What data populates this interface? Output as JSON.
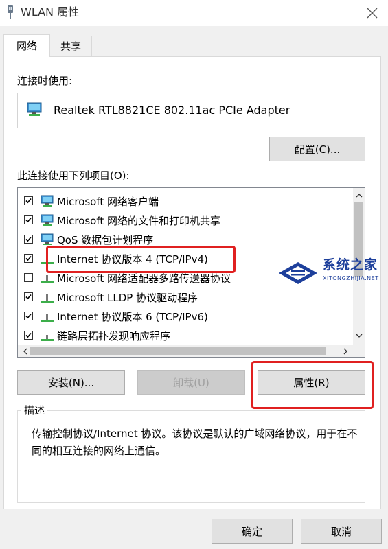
{
  "window": {
    "title": "WLAN 属性",
    "close_icon": "close-icon"
  },
  "tabs": [
    {
      "label": "网络",
      "active": true
    },
    {
      "label": "共享",
      "active": false
    }
  ],
  "connect_using": {
    "label": "连接时使用:",
    "adapter": "Realtek RTL8821CE 802.11ac PCIe Adapter",
    "configure_button": "配置(C)..."
  },
  "items_section": {
    "label": "此连接使用下列项目(O):",
    "items": [
      {
        "label": "Microsoft 网络客户端",
        "checked": true,
        "icon": "network-client-icon"
      },
      {
        "label": "Microsoft 网络的文件和打印机共享",
        "checked": true,
        "icon": "file-printer-sharing-icon"
      },
      {
        "label": "QoS 数据包计划程序",
        "checked": true,
        "icon": "qos-icon"
      },
      {
        "label": "Internet 协议版本 4 (TCP/IPv4)",
        "checked": true,
        "icon": "protocol-icon"
      },
      {
        "label": "Microsoft 网络适配器多路传送器协议",
        "checked": false,
        "icon": "protocol-icon"
      },
      {
        "label": "Microsoft LLDP 协议驱动程序",
        "checked": true,
        "icon": "protocol-icon"
      },
      {
        "label": "Internet 协议版本 6 (TCP/IPv6)",
        "checked": true,
        "icon": "protocol-icon"
      },
      {
        "label": "链路层拓扑发现响应程序",
        "checked": true,
        "icon": "protocol-icon"
      }
    ]
  },
  "buttons": {
    "install": "安装(N)...",
    "uninstall": "卸载(U)",
    "properties": "属性(R)"
  },
  "description": {
    "title": "描述",
    "text": "传输控制协议/Internet 协议。该协议是默认的广域网络协议，用于在不同的相互连接的网络上通信。"
  },
  "footer": {
    "ok": "确定",
    "cancel": "取消"
  },
  "watermark": {
    "name": "系统之家",
    "url": "XITONGZHIJIA.NET"
  },
  "colors": {
    "highlight": "#e02020",
    "watermark": "#1d3f9b"
  }
}
